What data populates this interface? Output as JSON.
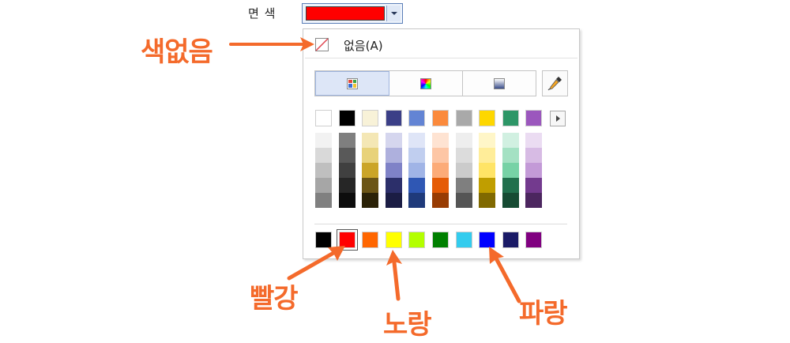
{
  "fill_label": "면 색",
  "combo": {
    "selected_color": "#ff0000"
  },
  "panel": {
    "no_color_label": "없음(A)",
    "tabs": [
      {
        "name": "palette-tab",
        "icon": "palette-grid-icon",
        "active": true
      },
      {
        "name": "spectrum-tab",
        "icon": "color-spectrum-icon",
        "active": false
      },
      {
        "name": "gradient-tab",
        "icon": "gradient-icon",
        "active": false
      }
    ],
    "picker_icon": "eyedropper-icon",
    "theme_colors": [
      "#ffffff",
      "#000000",
      "#f8f2d8",
      "#3b3f87",
      "#6384d4",
      "#fb8a3c",
      "#a9a9a9",
      "#fed700",
      "#2d9667",
      "#9b57bd"
    ],
    "shades": [
      [
        "#f2f2f2",
        "#d9d9d9",
        "#bfbfbf",
        "#a6a6a6",
        "#808080"
      ],
      [
        "#7f7f7f",
        "#595959",
        "#404040",
        "#262626",
        "#0d0d0d"
      ],
      [
        "#f4e7b5",
        "#e8d27a",
        "#cba528",
        "#6b5516",
        "#2b2207"
      ],
      [
        "#d5d6ee",
        "#aeb0dd",
        "#7f82c7",
        "#2c2f6a",
        "#1b1d44"
      ],
      [
        "#dfe5f7",
        "#c0ceef",
        "#a0b4e6",
        "#2f57b4",
        "#1f3a7a"
      ],
      [
        "#fee3d2",
        "#fdc6a5",
        "#fcab78",
        "#e55b06",
        "#983c03"
      ],
      [
        "#eeeeee",
        "#dcdcdc",
        "#cbcbcb",
        "#7f7f7f",
        "#555555"
      ],
      [
        "#fff6c8",
        "#ffed99",
        "#ffe466",
        "#c09e00",
        "#806900"
      ],
      [
        "#d1f0e1",
        "#a4e1c3",
        "#77d2a6",
        "#21704d",
        "#164b33"
      ],
      [
        "#ebdcf2",
        "#d7bbe4",
        "#c39ad7",
        "#733a8e",
        "#4c265f"
      ]
    ],
    "standard_colors": [
      "#000000",
      "#ff0000",
      "#ff6600",
      "#ffff00",
      "#b3ff00",
      "#008000",
      "#33ccee",
      "#0000ff",
      "#1a1a66",
      "#800080"
    ],
    "selected_standard_index": 1
  },
  "annotations": {
    "no_color": "색없음",
    "red": "빨강",
    "yellow": "노랑",
    "blue": "파랑",
    "color": "#f46a2b"
  }
}
